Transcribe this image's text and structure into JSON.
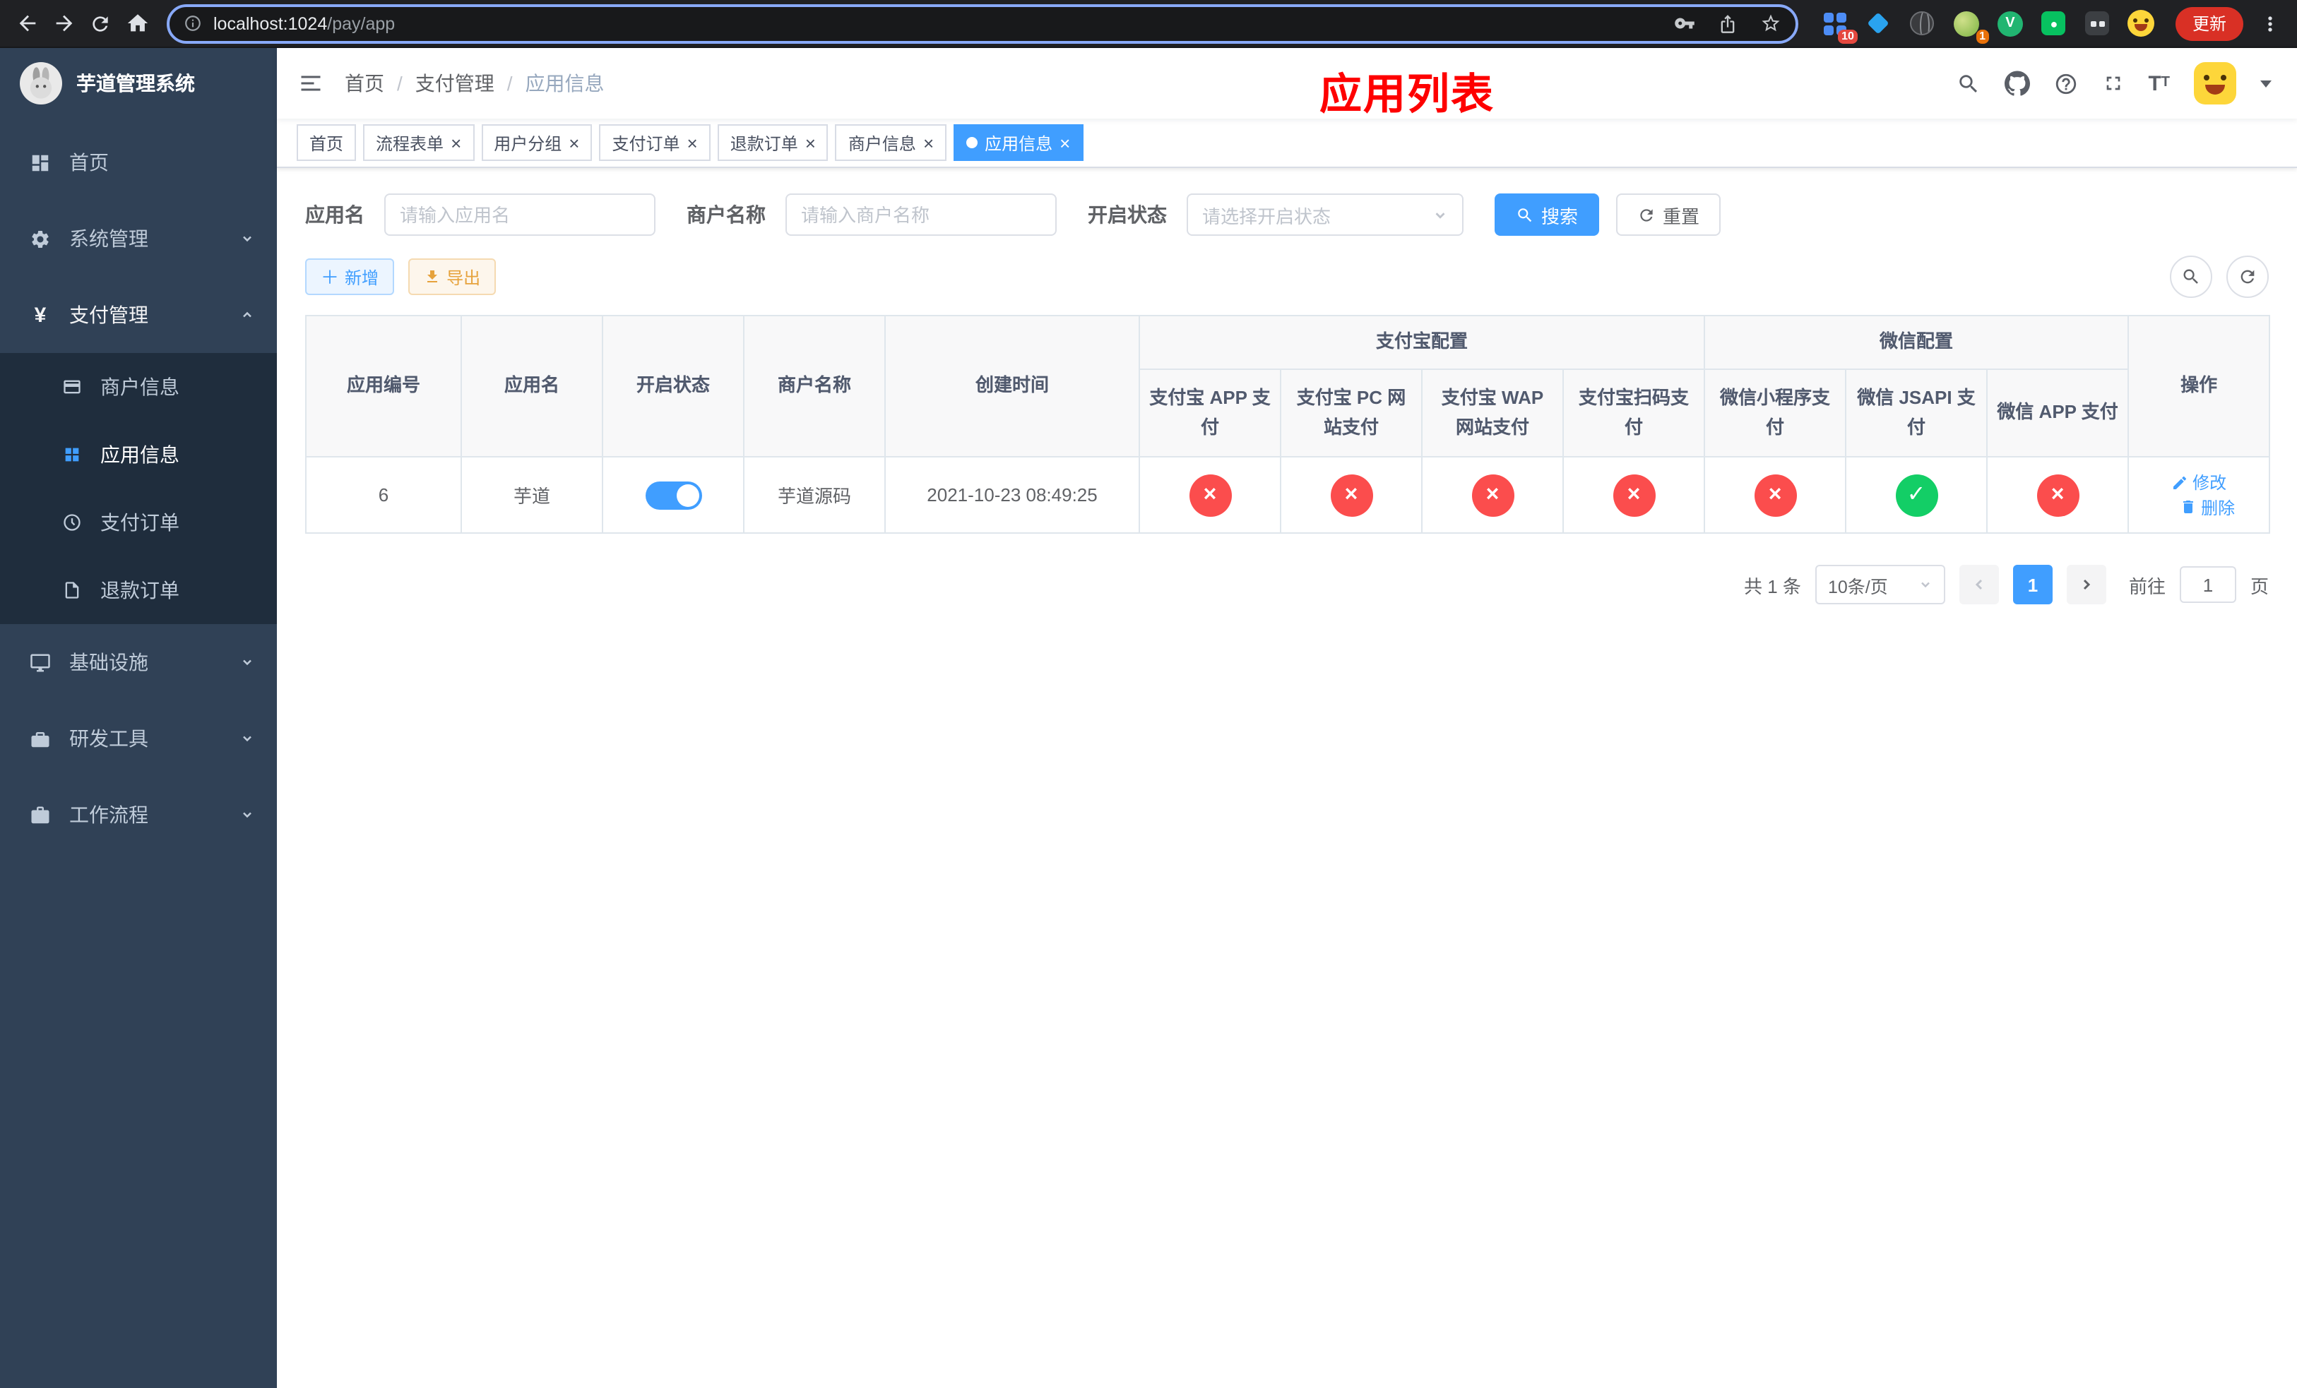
{
  "colors": {
    "accent": "#409eff",
    "success": "#13ce66",
    "danger": "#fb4d4d",
    "sidebar_bg": "#304156",
    "submenu_bg": "#1f2d3d",
    "annotation_red": "#fe0000"
  },
  "browser": {
    "url_host": "localhost:1024",
    "url_path": "/pay/app",
    "update_label": "更新",
    "extension_badge_grid": "10",
    "extension_badge_avatar": "1"
  },
  "sidebar": {
    "title": "芋道管理系统",
    "menu": [
      {
        "label": "首页"
      },
      {
        "label": "系统管理"
      },
      {
        "label": "支付管理"
      },
      {
        "label": "基础设施"
      },
      {
        "label": "研发工具"
      },
      {
        "label": "工作流程"
      }
    ],
    "submenu": [
      {
        "label": "商户信息"
      },
      {
        "label": "应用信息"
      },
      {
        "label": "支付订单"
      },
      {
        "label": "退款订单"
      }
    ]
  },
  "navbar": {
    "breadcrumb": [
      "首页",
      "支付管理",
      "应用信息"
    ],
    "annotation": "应用列表"
  },
  "tabs": [
    {
      "label": "首页"
    },
    {
      "label": "流程表单"
    },
    {
      "label": "用户分组"
    },
    {
      "label": "支付订单"
    },
    {
      "label": "退款订单"
    },
    {
      "label": "商户信息"
    },
    {
      "label": "应用信息"
    }
  ],
  "filters": {
    "app_name_label": "应用名",
    "app_name_placeholder": "请输入应用名",
    "merchant_label": "商户名称",
    "merchant_placeholder": "请输入商户名称",
    "status_label": "开启状态",
    "status_placeholder": "请选择开启状态",
    "search_label": "搜索",
    "reset_label": "重置"
  },
  "toolbar": {
    "add_label": "新增",
    "export_label": "导出"
  },
  "table": {
    "columns": {
      "id": "应用编号",
      "name": "应用名",
      "enabled": "开启状态",
      "merchant": "商户名称",
      "created": "创建时间",
      "ops": "操作"
    },
    "groups": {
      "alipay_title": "支付宝配置",
      "alipay_channels": [
        "支付宝 APP 支付",
        "支付宝 PC 网站支付",
        "支付宝 WAP 网站支付",
        "支付宝扫码支付"
      ],
      "wechat_title": "微信配置",
      "wechat_channels": [
        "微信小程序支付",
        "微信 JSAPI 支付",
        "微信 APP 支付"
      ]
    },
    "row": {
      "id": "6",
      "name": "芋道",
      "enabled": true,
      "merchant": "芋道源码",
      "created": "2021-10-23 08:49:25",
      "statuses": [
        false,
        false,
        false,
        false,
        false,
        true,
        false
      ],
      "edit_label": "修改",
      "delete_label": "删除"
    }
  },
  "pagination": {
    "total_label": "共 1 条",
    "page_size_label": "10条/页",
    "current_page": "1",
    "goto_label": "前往",
    "goto_value": "1",
    "page_unit": "页"
  }
}
